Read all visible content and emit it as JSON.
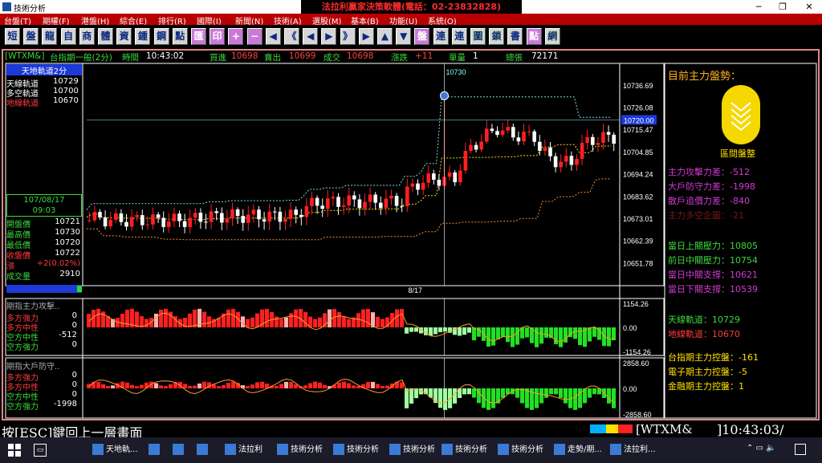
{
  "window": {
    "title": "技術分析",
    "banner": "法拉利贏家決策軟體(電話：02-23832828)"
  },
  "menu": [
    "台盤(T)",
    "期權(F)",
    "港盤(H)",
    "綜合(E)",
    "排行(R)",
    "國際(I)",
    "新聞(N)",
    "技術(A)",
    "選股(M)",
    "基本(B)",
    "功能(U)",
    "系統(O)"
  ],
  "toolbar": [
    "短",
    "盤",
    "龍",
    "自",
    "商",
    "體",
    "資",
    "鍾",
    "鋼",
    "點",
    "匯",
    "印",
    "+",
    "−",
    "◀",
    "《",
    "◀",
    "▶",
    "》",
    "▶",
    "▲",
    "▼",
    "盤",
    "連",
    "連",
    "圖",
    "鎖",
    "書",
    "點",
    "網"
  ],
  "status": {
    "symbol": "[WTXM&]",
    "name": "台指期一般(2分)",
    "time_label": "時間",
    "time": "10:43:02",
    "bid_label": "買進",
    "bid": "10698",
    "ask_label": "賣出",
    "ask": "10699",
    "deal_label": "成交",
    "deal": "10698",
    "chg_label": "漲跌",
    "chg": "+11",
    "vol_label": "單量",
    "vol": "1",
    "total_label": "總張",
    "total": "72171"
  },
  "left_panel": {
    "header": "天地軌道2分",
    "tracks": [
      {
        "label": "天線軌道",
        "value": "10729",
        "color": "#ffffff"
      },
      {
        "label": "多空軌道",
        "value": "10700",
        "color": "#ffffff"
      },
      {
        "label": "地線軌道",
        "value": "10670",
        "color": "#ff3b3b"
      }
    ],
    "date": "107/08/17",
    "time": "09:03",
    "quote": [
      {
        "label": "開盤價",
        "value": "10721"
      },
      {
        "label": "最高價",
        "value": "10730"
      },
      {
        "label": "最低價",
        "value": "10720"
      },
      {
        "label": "收盤價",
        "value": "10722"
      },
      {
        "label": "漲",
        "value": "+2(0.02%)"
      },
      {
        "label": "成交量",
        "value": "2910"
      }
    ]
  },
  "main_chart": {
    "marker": "10730",
    "x_label": "8/17",
    "y_ticks": [
      "10736.69",
      "10726.08",
      "10715.47",
      "10704.85",
      "10694.24",
      "10683.62",
      "10673.01",
      "10662.39",
      "10651.78"
    ],
    "cursor_price": "10720.00"
  },
  "sub1": {
    "title": "期指主力攻擊..",
    "rows": [
      {
        "label": "多方強力",
        "value": "0",
        "color": "#ff3b3b"
      },
      {
        "label": "多方中性",
        "value": "0",
        "color": "#ff3b3b"
      },
      {
        "label": "空方中性",
        "value": "-512",
        "color": "#3cd83c"
      },
      {
        "label": "空方強力",
        "value": "0",
        "color": "#3cd83c"
      }
    ],
    "y_ticks": [
      "1154.26",
      "0.00",
      "-1154.26"
    ]
  },
  "sub2": {
    "title": "期指大戶防守..",
    "rows": [
      {
        "label": "多方強力",
        "value": "0",
        "color": "#ff3b3b"
      },
      {
        "label": "多方中性",
        "value": "0",
        "color": "#ff3b3b"
      },
      {
        "label": "空方中性",
        "value": "0",
        "color": "#3cd83c"
      },
      {
        "label": "空方強力",
        "value": "-1998",
        "color": "#3cd83c"
      }
    ],
    "y_ticks": [
      "2858.60",
      "0.00",
      "-2858.60"
    ]
  },
  "right_panel": {
    "heading": "目前主力盤勢：",
    "badge": "區間盤整",
    "forces": [
      {
        "label": "主力攻擊力差",
        "value": "-512",
        "color": "#d23ad2"
      },
      {
        "label": "大戶防守力差",
        "value": "-1998",
        "color": "#d23ad2"
      },
      {
        "label": "散戶追價力差",
        "value": "-840",
        "color": "#d23ad2"
      },
      {
        "label": "主力多空企圖",
        "value": "-21",
        "color": "#7a1818"
      }
    ],
    "levels": [
      {
        "label": "當日上關壓力",
        "value": "10805",
        "color": "#3cd83c"
      },
      {
        "label": "前日中關壓力",
        "value": "10754",
        "color": "#3cd83c"
      },
      {
        "label": "當日中關支撐",
        "value": "10621",
        "color": "#d23ad2"
      },
      {
        "label": "當日下關支撐",
        "value": "10539",
        "color": "#d23ad2"
      }
    ],
    "tracks": [
      {
        "label": "天線軌道",
        "value": "10729",
        "color": "#3cd83c"
      },
      {
        "label": "地線軌道",
        "value": "10670",
        "color": "#ff3b3b"
      }
    ],
    "control": [
      {
        "label": "台指期主力控盤",
        "value": "-161"
      },
      {
        "label": "電子期主力控盤",
        "value": "-5"
      },
      {
        "label": "金融期主力控盤",
        "value": "1"
      }
    ]
  },
  "footer": {
    "hint": "按[ESC]鍵回上一層畫面",
    "symbol": "WTXM&",
    "clock": "10:43:03"
  },
  "taskbar": [
    {
      "label": "天地軌..."
    },
    {
      "label": ""
    },
    {
      "label": ""
    },
    {
      "label": ""
    },
    {
      "label": "法拉利"
    },
    {
      "label": "技術分析"
    },
    {
      "label": "技術分析"
    },
    {
      "label": "技術分析"
    },
    {
      "label": "技術分析"
    },
    {
      "label": "技術分析"
    },
    {
      "label": "走勢/期..."
    },
    {
      "label": "法拉利..."
    }
  ],
  "colors": {
    "up": "#ff2020",
    "down": "#ffffff",
    "neutral_up": "#ffb0b0",
    "neutral_down": "#a0ffa0",
    "green": "#22e022",
    "accent": "#3cd83c"
  },
  "chart_data": {
    "type": "candlestick",
    "x_label": "8/17",
    "ylim": [
      10645,
      10742
    ],
    "candles": [],
    "sub1_values": [],
    "sub2_values": []
  }
}
